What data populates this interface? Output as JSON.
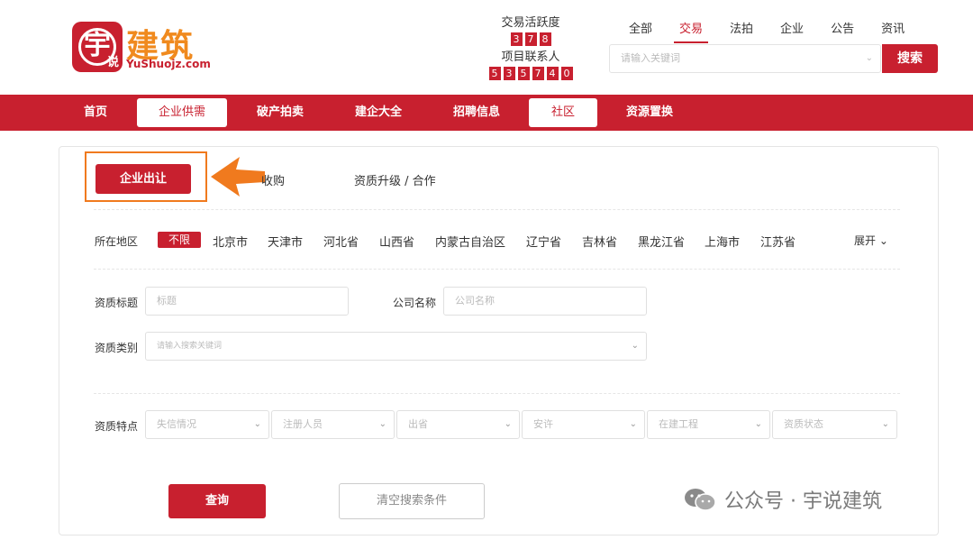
{
  "logo": {
    "badge_char": "宇",
    "badge_small": "说",
    "name_cn": "建筑",
    "name_en": "YuShuojz.com"
  },
  "stats": [
    {
      "label": "交易活跃度",
      "digits": [
        "3",
        "7",
        "8"
      ]
    },
    {
      "label": "项目联系人",
      "digits": [
        "5",
        "3",
        "5",
        "7",
        "4",
        "0"
      ]
    }
  ],
  "search": {
    "tabs": [
      "全部",
      "交易",
      "法拍",
      "企业",
      "公告",
      "资讯"
    ],
    "active_tab": "交易",
    "placeholder": "请输入关键词",
    "button": "搜索"
  },
  "nav": {
    "items": [
      "首页",
      "企业供需",
      "破产拍卖",
      "建企大全",
      "招聘信息",
      "社区",
      "资源置换"
    ]
  },
  "subtabs": {
    "active": "企业出让",
    "second": "收购",
    "third": "资质升级 / 合作"
  },
  "filters": {
    "region_label": "所在地区",
    "region_selected": "不限",
    "regions": [
      "北京市",
      "天津市",
      "河北省",
      "山西省",
      "内蒙古自治区",
      "辽宁省",
      "吉林省",
      "黑龙江省",
      "上海市",
      "江苏省"
    ],
    "expand": "展开",
    "title_label": "资质标题",
    "title_placeholder": "标题",
    "company_label": "公司名称",
    "company_placeholder": "公司名称",
    "category_label": "资质类别",
    "category_placeholder": "请输入搜索关键词",
    "features_label": "资质特点",
    "feature_selects": [
      "失信情况",
      "注册人员",
      "出省",
      "安许",
      "在建工程",
      "资质状态"
    ]
  },
  "actions": {
    "query": "查询",
    "clear": "清空搜索条件"
  },
  "watermark": {
    "text": "公众号 · 宇说建筑"
  },
  "colors": {
    "brand_red": "#c8202f",
    "logo_orange": "#f08a1e",
    "highlight_orange": "#f07a1e"
  }
}
